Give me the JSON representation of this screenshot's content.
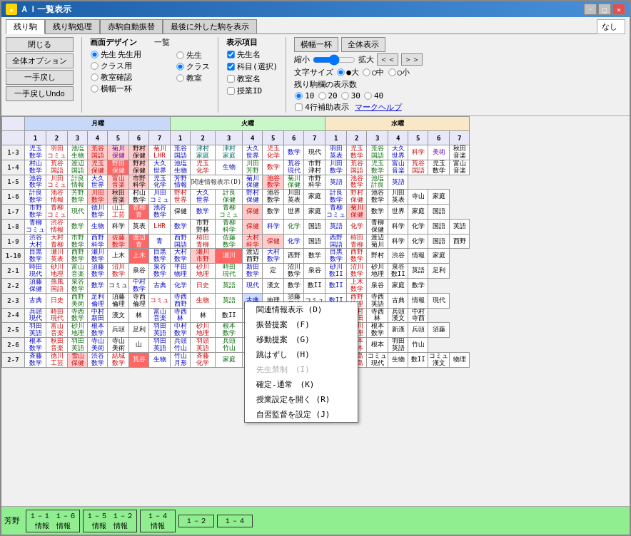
{
  "window": {
    "title": "ＡＩ一覧表示",
    "icon": "★"
  },
  "toolbar": {
    "close_label": "閉じる",
    "screen_design_label": "画面デザイン",
    "list_label": "一覧",
    "display_items_label": "表示項目",
    "fit_width_label": "横幅一杯",
    "full_display_label": "全体表示",
    "remaining_label": "残り駒",
    "remaining_process_label": "残り駒処理",
    "auto_replace_label": "赤駒自動振替",
    "last_removed_label": "最後に外した駒を表示",
    "whole_option_label": "全体オプション",
    "one_back_label": "一手戻し",
    "class_use_label": "クラス用",
    "room_confirm_label": "教室確認",
    "one_back_undo_label": "一手戻しUndo",
    "width_one_label": "横幅一杯",
    "zoom_out": "縮小",
    "zoom_in": "拡大",
    "nav_prev": "＜＜",
    "nav_next": "＞＞",
    "font_size_label": "文字サイズ",
    "font_large": "●大",
    "font_medium": "○中",
    "font_small": "○小",
    "remaining_count_label": "残り駒欄の表示数",
    "count_10": "10",
    "count_20": "20",
    "count_30": "30",
    "count_40": "40",
    "assist_label": "4行補助表示",
    "mark_help_label": "マークヘルプ",
    "nashi_label": "なし",
    "radio_teacher": "先生",
    "radio_class": "クラス",
    "radio_teacher2": "先生",
    "radio_class2": "クラス",
    "radio_room": "教室",
    "check_teacher_name": "先生名",
    "check_subject": "科目(選択)",
    "check_room": "教室名",
    "check_lesson_id": "授業ID"
  },
  "context_menu": {
    "items": [
      {
        "label": "関連情報表示 (D)",
        "key": "D",
        "enabled": true
      },
      {
        "label": "振替提案　(F)",
        "key": "F",
        "enabled": true
      },
      {
        "label": "移動提案　(G)",
        "key": "G",
        "enabled": true
      },
      {
        "label": "跳はずし　(H)",
        "key": "H",
        "enabled": true
      },
      {
        "label": "先生禁制　(I)",
        "key": "I",
        "enabled": false
      },
      {
        "label": "確定-通常　(K)",
        "key": "K",
        "enabled": true
      },
      {
        "label": "授業設定を開く (R)",
        "key": "R",
        "enabled": true
      },
      {
        "label": "自習監督を設定 (J)",
        "key": "J",
        "enabled": true
      }
    ]
  },
  "days": [
    "月曜",
    "火曜",
    "水曜"
  ],
  "periods": [
    "1",
    "2",
    "3",
    "4",
    "5",
    "6",
    "7"
  ],
  "row_headers": [
    "1-3",
    "1-4",
    "1-5",
    "1-6",
    "1-7",
    "1-8",
    "1-9",
    "1-10",
    "2-1",
    "2-2",
    "2-3",
    "2-4",
    "2-5",
    "2-6",
    "2-7"
  ],
  "bottom_bar": {
    "label": "芳野",
    "cells": [
      {
        "id": "1-1 1-6",
        "line1": "1－1 1－6",
        "line2": "情報 情報"
      },
      {
        "id": "1-5 1-2",
        "line1": "1－5 1－2",
        "line2": "情報 情報"
      },
      {
        "id": "1-4",
        "line1": "1－4",
        "line2": "情報"
      },
      {
        "id": "1-2",
        "line1": "1－2",
        "line2": ""
      },
      {
        "id": "1-4b",
        "line1": "1－4",
        "line2": ""
      }
    ]
  }
}
